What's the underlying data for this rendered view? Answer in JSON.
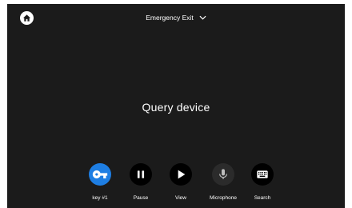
{
  "header": {
    "home_icon": "home-icon",
    "title": "Emergency Exit",
    "dropdown_icon": "chevron-down-icon"
  },
  "main": {
    "status_text": "Query device"
  },
  "controls": [
    {
      "label": "key #1",
      "icon": "key-icon",
      "color": "#1e7ee3",
      "active": true
    },
    {
      "label": "Pause",
      "icon": "pause-icon",
      "color": "#000000",
      "active": false
    },
    {
      "label": "View",
      "icon": "play-icon",
      "color": "#000000",
      "active": false
    },
    {
      "label": "Microphone",
      "icon": "microphone-icon",
      "color": "#2b2b2b",
      "active": false
    },
    {
      "label": "Search",
      "icon": "keyboard-icon",
      "color": "#000000",
      "active": false
    }
  ],
  "colors": {
    "background": "#1b1b1b",
    "accent": "#1e7ee3",
    "text": "#ffffff"
  }
}
